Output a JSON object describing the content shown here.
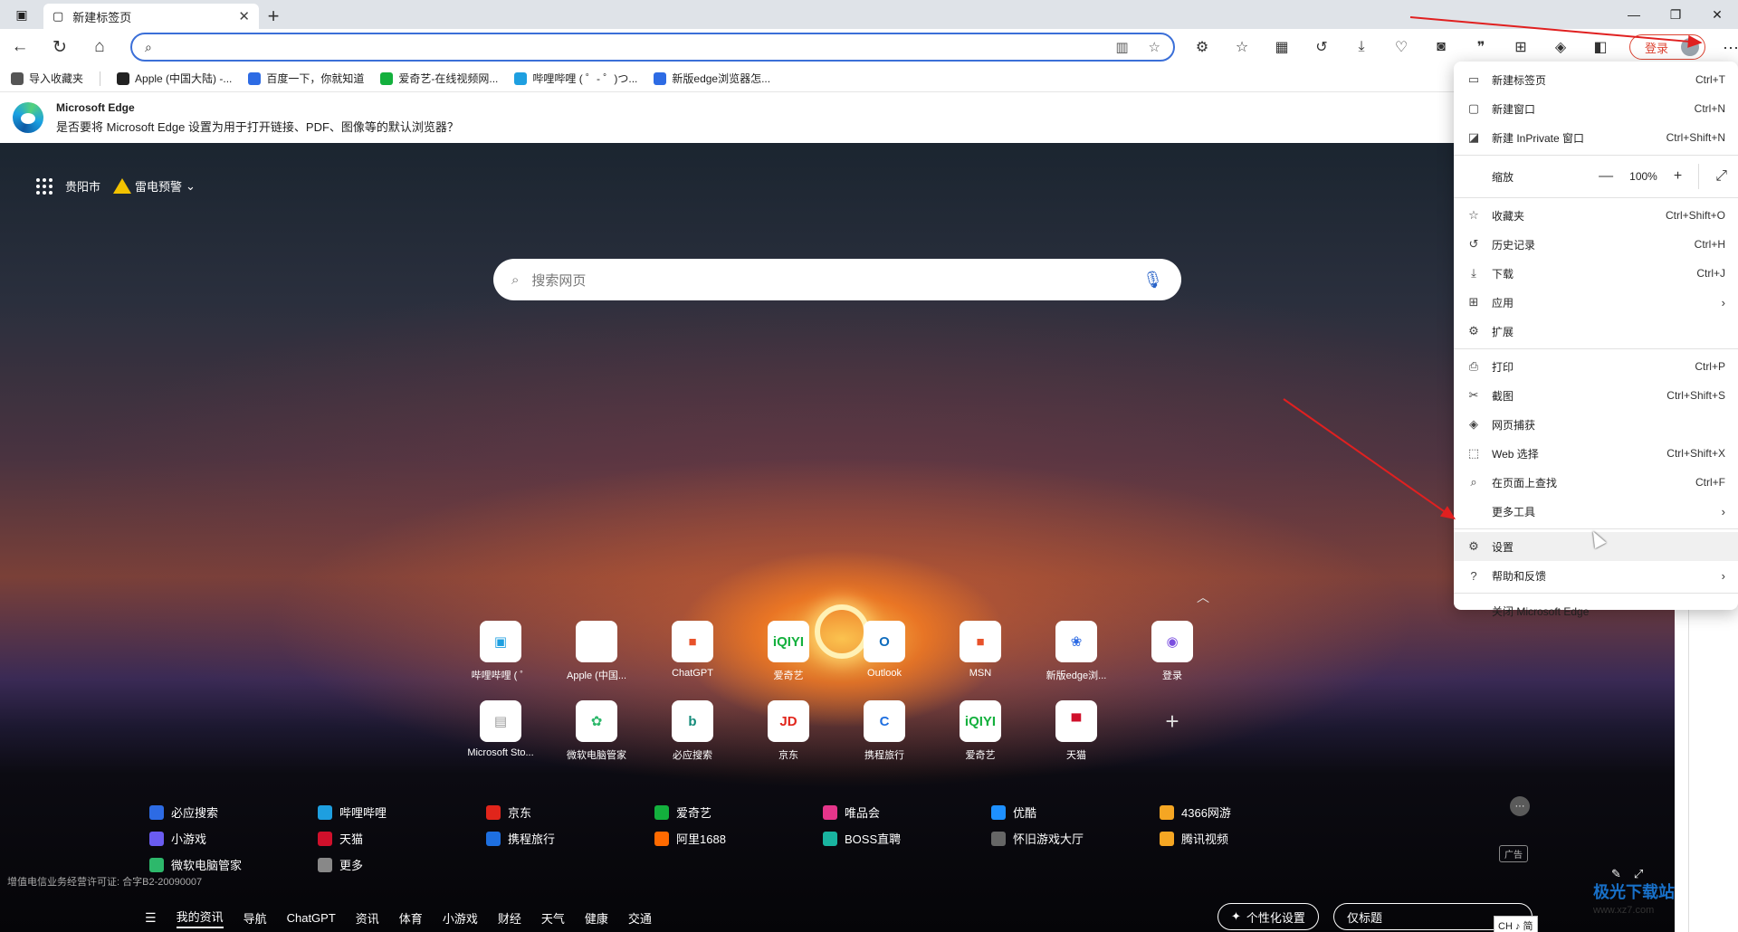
{
  "tabs": [
    {
      "title": "新建标签页"
    }
  ],
  "address": {
    "value": "",
    "placeholder": ""
  },
  "toolbar": {
    "login_label": "登录"
  },
  "favorites": [
    {
      "label": "导入收藏夹",
      "color": "#555555"
    },
    {
      "label": "Apple (中国大陆) -...",
      "color": "#222222"
    },
    {
      "label": "百度一下，你就知道",
      "color": "#2d6be4"
    },
    {
      "label": "爱奇艺-在线视频网...",
      "color": "#13b03d"
    },
    {
      "label": "哔哩哔哩 ( ゜- ゜)つ...",
      "color": "#1e9fe0"
    },
    {
      "label": "新版edge浏览器怎...",
      "color": "#2d6be4"
    }
  ],
  "banner": {
    "title": "Microsoft Edge",
    "message": "是否要将 Microsoft Edge 设置为用于打开链接、PDF、图像等的默认浏览器？"
  },
  "location": {
    "city": "贵阳市",
    "alert": "雷电预警"
  },
  "search": {
    "placeholder": "搜索网页"
  },
  "tiles": [
    {
      "label": "哔哩哔哩 ( ゜",
      "glyph": "▣",
      "color": "#1e9fe0"
    },
    {
      "label": "Apple (中国...",
      "glyph": "",
      "color": "#111111"
    },
    {
      "label": "ChatGPT",
      "glyph": "■",
      "color": "#e8512a"
    },
    {
      "label": "爱奇艺",
      "glyph": "iQIYI",
      "color": "#13b03d"
    },
    {
      "label": "Outlook",
      "glyph": "O",
      "color": "#0f6cbd"
    },
    {
      "label": "MSN",
      "glyph": "■",
      "color": "#e8512a"
    },
    {
      "label": "新版edge浏...",
      "glyph": "❀",
      "color": "#2d6be4"
    },
    {
      "label": "登录",
      "glyph": "◉",
      "color": "#7b4fe0"
    },
    {
      "label": "Microsoft Sto...",
      "glyph": "▤",
      "color": "#999999"
    },
    {
      "label": "微软电脑管家",
      "glyph": "✿",
      "color": "#2db86b"
    },
    {
      "label": "必应搜索",
      "glyph": "b",
      "color": "#138b7a"
    },
    {
      "label": "京东",
      "glyph": "JD",
      "color": "#e1251b"
    },
    {
      "label": "携程旅行",
      "glyph": "C",
      "color": "#1e6fe0"
    },
    {
      "label": "爱奇艺",
      "glyph": "iQIYI",
      "color": "#13b03d"
    },
    {
      "label": "天猫",
      "glyph": "▀",
      "color": "#d0102b"
    },
    {
      "label": "",
      "glyph": "+",
      "color": "#dddddd"
    }
  ],
  "quick_links": [
    {
      "label": "必应搜索",
      "color": "#2d6be4"
    },
    {
      "label": "哔哩哔哩",
      "color": "#1e9fe0"
    },
    {
      "label": "京东",
      "color": "#e1251b"
    },
    {
      "label": "爱奇艺",
      "color": "#13b03d"
    },
    {
      "label": "唯品会",
      "color": "#e5358a"
    },
    {
      "label": "优酷",
      "color": "#1e90ff"
    },
    {
      "label": "4366网游",
      "color": "#f5a623"
    },
    {
      "label": "小游戏",
      "color": "#6a5cf0"
    },
    {
      "label": "天猫",
      "color": "#d0102b"
    },
    {
      "label": "携程旅行",
      "color": "#1e6fe0"
    },
    {
      "label": "阿里1688",
      "color": "#ff6a00"
    },
    {
      "label": "BOSS直聘",
      "color": "#19b4a0"
    },
    {
      "label": "怀旧游戏大厅",
      "color": "#666666"
    },
    {
      "label": "腾讯视频",
      "color": "#f5a623"
    },
    {
      "label": "微软电脑管家",
      "color": "#2db86b"
    },
    {
      "label": "更多",
      "color": "#888888"
    }
  ],
  "ad_label": "广告",
  "license": "增值电信业务经营许可证: 合字B2-20090007",
  "footer_nav": [
    "我的资讯",
    "导航",
    "ChatGPT",
    "资讯",
    "体育",
    "小游戏",
    "财经",
    "天气",
    "健康",
    "交通"
  ],
  "footer_pills": {
    "personalize": "个性化设置",
    "title_only": "仅标题"
  },
  "ime": "CH ♪ 简",
  "watermark": {
    "title": "极光下载站",
    "url": "www.xz7.com"
  },
  "menu": {
    "group1": [
      {
        "label": "新建标签页",
        "shortcut": "Ctrl+T",
        "icon": "▭"
      },
      {
        "label": "新建窗口",
        "shortcut": "Ctrl+N",
        "icon": "▢"
      },
      {
        "label": "新建 InPrivate 窗口",
        "shortcut": "Ctrl+Shift+N",
        "icon": "◪"
      }
    ],
    "zoom": {
      "label": "缩放",
      "minus": "—",
      "value": "100%",
      "plus": "+",
      "fullscreen": "⤢"
    },
    "group2": [
      {
        "label": "收藏夹",
        "shortcut": "Ctrl+Shift+O",
        "icon": "☆"
      },
      {
        "label": "历史记录",
        "shortcut": "Ctrl+H",
        "icon": "↺"
      },
      {
        "label": "下载",
        "shortcut": "Ctrl+J",
        "icon": "⤓"
      },
      {
        "label": "应用",
        "shortcut": "",
        "icon": "⊞",
        "chevron": "›"
      },
      {
        "label": "扩展",
        "shortcut": "",
        "icon": "⚙"
      }
    ],
    "group3": [
      {
        "label": "打印",
        "shortcut": "Ctrl+P",
        "icon": "⎙"
      },
      {
        "label": "截图",
        "shortcut": "Ctrl+Shift+S",
        "icon": "✂"
      },
      {
        "label": "网页捕获",
        "shortcut": "",
        "icon": "◈"
      },
      {
        "label": "Web 选择",
        "shortcut": "Ctrl+Shift+X",
        "icon": "⬚"
      },
      {
        "label": "在页面上查找",
        "shortcut": "Ctrl+F",
        "icon": "⌕"
      },
      {
        "label": "更多工具",
        "shortcut": "",
        "icon": "",
        "chevron": "›"
      }
    ],
    "group4": [
      {
        "label": "设置",
        "shortcut": "",
        "icon": "⚙"
      },
      {
        "label": "帮助和反馈",
        "shortcut": "",
        "icon": "?",
        "chevron": "›"
      }
    ],
    "close_label": "关闭 Microsoft Edge"
  }
}
